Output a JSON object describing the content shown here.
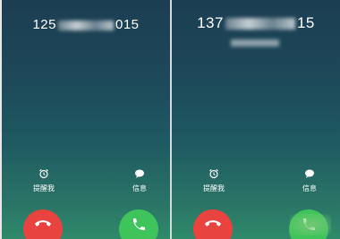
{
  "screens": [
    {
      "number_start": "125",
      "number_end": "015",
      "actions": [
        {
          "label": "提醒我",
          "icon": "alarm-clock-icon"
        },
        {
          "label": "信息",
          "icon": "message-icon"
        }
      ]
    },
    {
      "number_start": "137",
      "number_end": "15",
      "actions": [
        {
          "label": "提醒我",
          "icon": "alarm-clock-icon"
        },
        {
          "label": "信息",
          "icon": "message-icon"
        }
      ]
    }
  ],
  "colors": {
    "decline": "#e8433f",
    "accept": "#3fc45b"
  }
}
